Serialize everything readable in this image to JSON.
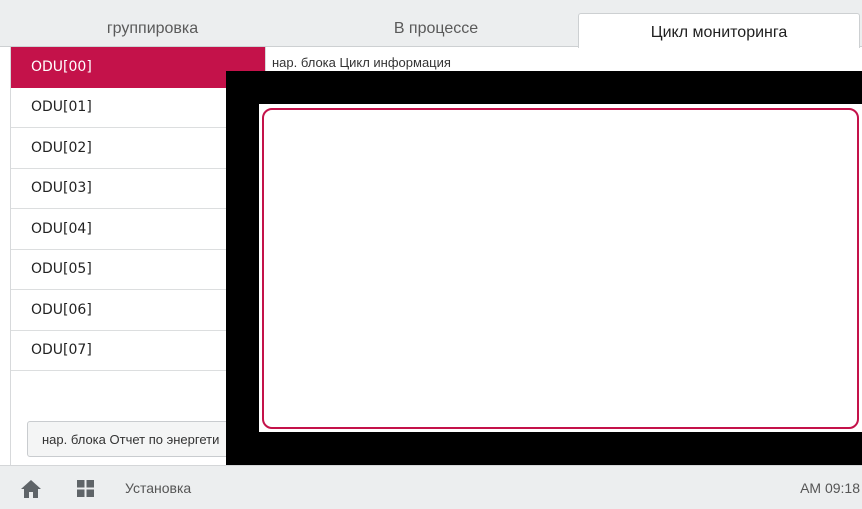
{
  "tabs": [
    {
      "label": "группировка"
    },
    {
      "label": "В процессе"
    },
    {
      "label": "Цикл мониторинга"
    }
  ],
  "sidebar": {
    "items": [
      {
        "label": "ODU[00]"
      },
      {
        "label": "ODU[01]"
      },
      {
        "label": "ODU[02]"
      },
      {
        "label": "ODU[03]"
      },
      {
        "label": "ODU[04]"
      },
      {
        "label": "ODU[05]"
      },
      {
        "label": "ODU[06]"
      },
      {
        "label": "ODU[07]"
      }
    ],
    "report_button_label": "нар. блока Отчет по энергети"
  },
  "main": {
    "info_label": "нар. блока Цикл информация"
  },
  "bottombar": {
    "setup_label": "Установка",
    "clock": "AM 09:18"
  },
  "colors": {
    "accent": "#c4124a"
  }
}
